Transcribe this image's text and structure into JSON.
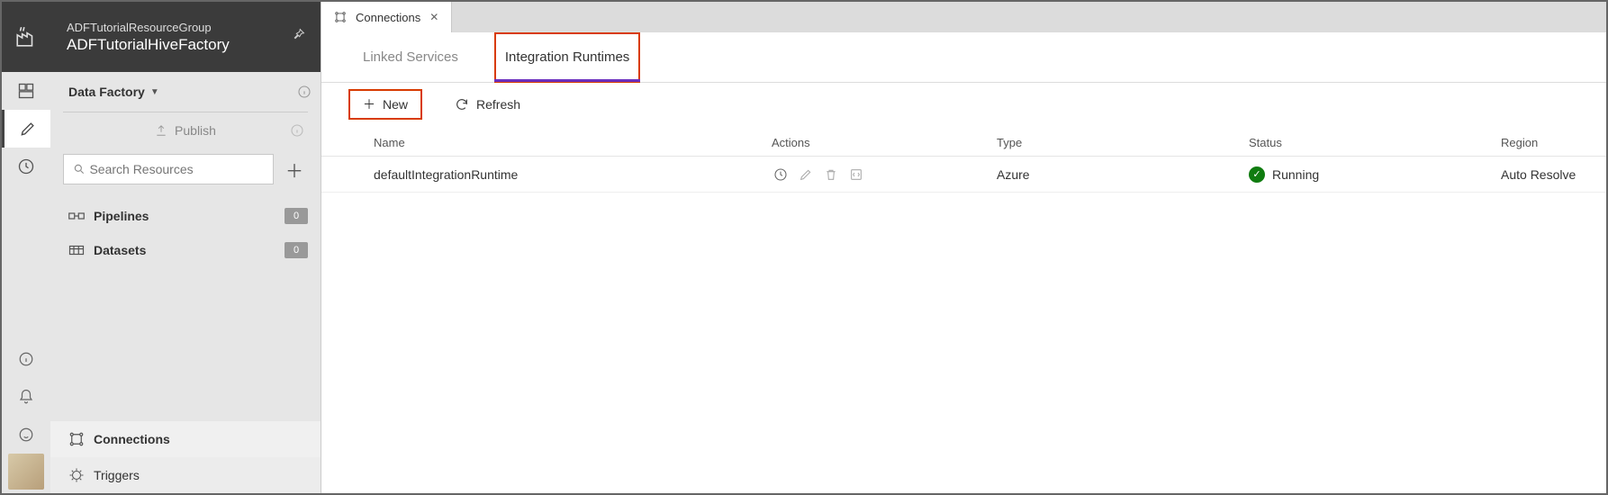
{
  "header": {
    "breadcrumb": "ADFTutorialResourceGroup",
    "factory_name": "ADFTutorialHiveFactory"
  },
  "sidebar": {
    "group_label": "Data Factory",
    "publish_label": "Publish",
    "search_placeholder": "Search Resources",
    "tree": [
      {
        "label": "Pipelines",
        "count": "0"
      },
      {
        "label": "Datasets",
        "count": "0"
      }
    ],
    "bottom": [
      {
        "label": "Connections"
      },
      {
        "label": "Triggers"
      }
    ]
  },
  "tabs": {
    "open": [
      {
        "label": "Connections"
      }
    ]
  },
  "subtabs": [
    {
      "label": "Linked Services"
    },
    {
      "label": "Integration Runtimes"
    }
  ],
  "toolbar": {
    "new_label": "New",
    "refresh_label": "Refresh"
  },
  "table": {
    "columns": {
      "name": "Name",
      "actions": "Actions",
      "type": "Type",
      "status": "Status",
      "region": "Region"
    },
    "rows": [
      {
        "name": "defaultIntegrationRuntime",
        "type": "Azure",
        "status": "Running",
        "region": "Auto Resolve"
      }
    ]
  }
}
